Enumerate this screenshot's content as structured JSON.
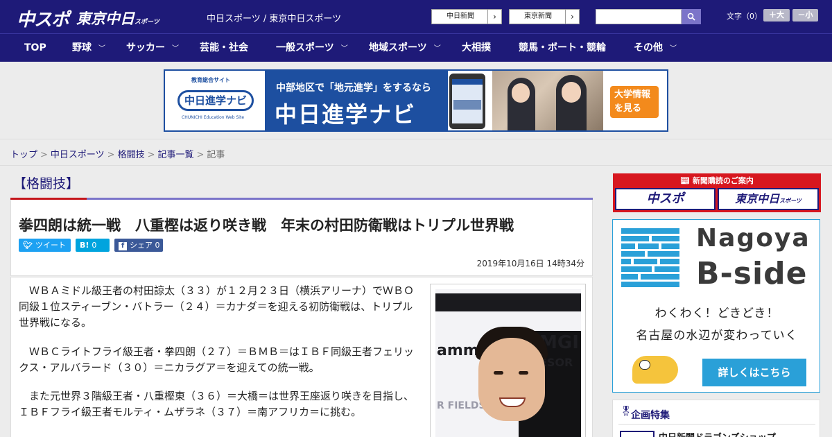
{
  "header": {
    "logo_chuspo": "中スポ",
    "logo_tokyo": "東京中日",
    "logo_tokyo_small": "スポーツ",
    "site_link": "中日スポーツ / 東京中日スポーツ",
    "btn_chunichi": "中日新聞",
    "btn_tokyo": "東京新聞",
    "search_placeholder": "",
    "font_label": "文字（0）",
    "font_plus": "＋大",
    "font_minus": "－小"
  },
  "nav": {
    "items": [
      "TOP",
      "野球",
      "サッカー",
      "芸能・社会",
      "一般スポーツ",
      "地域スポーツ",
      "大相撲",
      "競馬・ボート・競輪",
      "その他"
    ]
  },
  "banner": {
    "logo_small": "教育総合サイト",
    "logo_main": "中日進学ナビ",
    "logo_sub": "CHUNICHI Education Web Site",
    "line1": "中部地区で「地元進学」をするなら",
    "line2": "中日進学ナビ",
    "cta": "大学情報を見る"
  },
  "breadcrumb": {
    "items": [
      "トップ",
      "中日スポーツ",
      "格闘技",
      "記事一覧",
      "記事"
    ],
    "sep": ">"
  },
  "category": "【格闘技】",
  "article": {
    "headline": "拳四朗は統一戦　八重樫は返り咲き戦　年末の村田防衛戦はトリプル世界戦",
    "share_tw": "ツイート",
    "share_hb_icon": "B!",
    "share_hb_count": "0",
    "share_fb": "シェア",
    "share_fb_count": "0",
    "date": "2019年10月16日 14時34分",
    "paragraphs": [
      "　ＷＢＡミドル級王者の村田諒太（３３）が１２月２３日（横浜アリーナ）でＷＢＯ同級１位スティーブン・バトラー（２４）＝カナダ＝を迎える初防衛戦は、トリプル世界戦になる。",
      "　ＷＢＣライトフライ級王者・拳四朗（２７）＝ＢＭＢ＝はＩＢＦ同級王者フェリックス・アルバラード（３０）＝ニカラグア＝を迎えての統一戦。",
      "　また元世界３階級王者・八重樫東（３６）＝大橋＝は世界王座返り咲きを目指し、ＩＢＦフライ級王者モルティ・ムザラネ（３７）＝南アフリカ＝に挑む。"
    ]
  },
  "sidebar": {
    "subscribe_header": "新聞購読のご案内",
    "subscribe_chuspo": "中スポ",
    "subscribe_tokyo": "東京中日",
    "subscribe_tokyo_small": "スポーツ",
    "bside_title1": "Nagoya",
    "bside_title2": "B-side",
    "bside_line1": "わくわく！どきどき！",
    "bside_line2": "名古屋の水辺が変わっていく",
    "bside_cta": "詳しくはこちら",
    "feature_header": "企画特集",
    "feature_item": "中日新聞ドラゴンズショップ"
  },
  "colors": {
    "brand_navy": "#1e1a78",
    "accent_purple": "#7b74c9",
    "accent_red": "#c4161c",
    "twitter": "#1da1f2",
    "hatena": "#00a4de",
    "facebook": "#3b5998",
    "bside_blue": "#2aa0d8"
  }
}
